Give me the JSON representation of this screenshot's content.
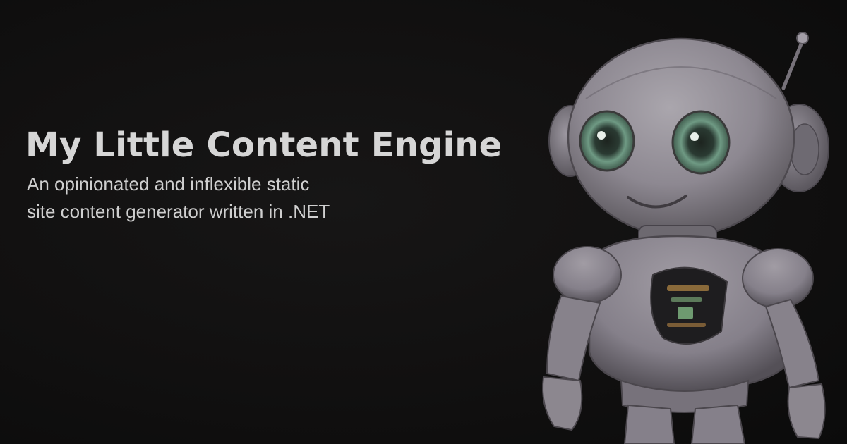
{
  "banner": {
    "title": "My Little Content Engine",
    "subtitle_lines": [
      "An opinionated and inflexible static",
      "site content generator written in .NET"
    ]
  },
  "illustration": {
    "icon": "robot-mascot-icon"
  },
  "colors": {
    "background": "#121111",
    "title": "#d6d6d6",
    "subtitle": "#cfcfcf",
    "robot_body": "#8f8a92",
    "robot_eye": "#6f9a84"
  }
}
